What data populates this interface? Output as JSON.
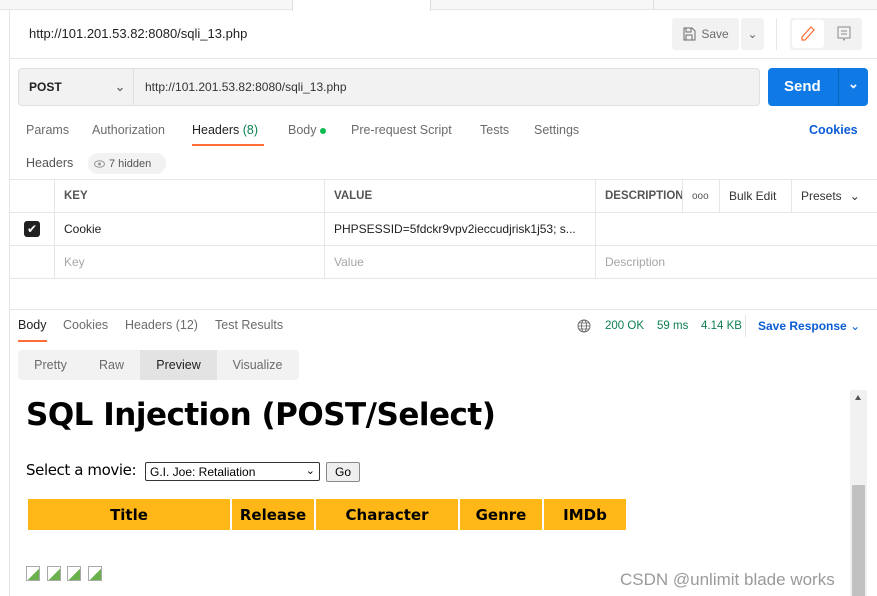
{
  "request": {
    "title": "http://101.201.53.82:8080/sqli_13.php",
    "save_label": "Save",
    "method": "POST",
    "url": "http://101.201.53.82:8080/sqli_13.php",
    "send_label": "Send"
  },
  "request_tabs": [
    {
      "label": "Params"
    },
    {
      "label": "Authorization"
    },
    {
      "label": "Headers",
      "count": "(8)"
    },
    {
      "label": "Body"
    },
    {
      "label": "Pre-request Script"
    },
    {
      "label": "Tests"
    },
    {
      "label": "Settings"
    }
  ],
  "cookies_label": "Cookies",
  "headers_section": {
    "label": "Headers",
    "hidden": "7 hidden"
  },
  "headers_table": {
    "columns": [
      "KEY",
      "VALUE",
      "DESCRIPTION"
    ],
    "more_label": "ooo",
    "bulk_edit": "Bulk Edit",
    "presets": "Presets",
    "rows": [
      {
        "checked": true,
        "key": "Cookie",
        "value": "PHPSESSID=5fdckr9vpv2ieccudjrisk1j53; s...",
        "description": ""
      }
    ],
    "placeholders": {
      "key": "Key",
      "value": "Value",
      "description": "Description"
    }
  },
  "response_tabs": [
    {
      "label": "Body"
    },
    {
      "label": "Cookies"
    },
    {
      "label": "Headers (12)"
    },
    {
      "label": "Test Results"
    }
  ],
  "status": {
    "code": "200 OK",
    "time": "59 ms",
    "size": "4.14 KB",
    "save_response": "Save Response"
  },
  "view_modes": [
    "Pretty",
    "Raw",
    "Preview",
    "Visualize"
  ],
  "active_view": "Preview",
  "preview": {
    "heading": "SQL Injection (POST/Select)",
    "select_label": "Select a movie:",
    "selected_movie": "G.I. Joe: Retaliation",
    "go_label": "Go",
    "table_headers": [
      "Title",
      "Release",
      "Character",
      "Genre",
      "IMDb"
    ]
  },
  "watermark": "CSDN @unlimit blade works",
  "colors": {
    "accent": "#ff6c37",
    "send": "#0f7ae5",
    "status": "#0d8050",
    "link": "#0b5cd5",
    "table_header": "#ffb717"
  }
}
